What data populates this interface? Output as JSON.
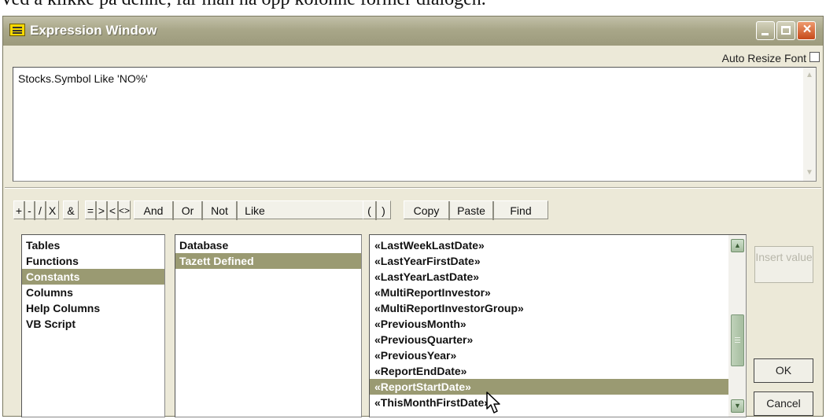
{
  "caption": "Ved å klikke på denne, får man nå opp kolonne former dialogen.",
  "window": {
    "title": "Expression Window"
  },
  "auto_resize": {
    "label": "Auto Resize Font",
    "checked": false
  },
  "expression": {
    "text": "Stocks.Symbol Like 'NO%'"
  },
  "operators": [
    "+",
    "-",
    "/",
    "X",
    "&",
    "=",
    ">",
    "<",
    "<>",
    "And",
    "Or",
    "Not",
    "Like",
    "(",
    ")",
    "Copy",
    "Paste",
    "Find"
  ],
  "categories": {
    "items": [
      "Tables",
      "Functions",
      "Constants",
      "Columns",
      "Help Columns",
      "VB Script"
    ],
    "selected": "Constants"
  },
  "sources": {
    "items": [
      "Database",
      "Tazett Defined"
    ],
    "selected": "Tazett Defined"
  },
  "values": {
    "items": [
      "«LastWeekLastDate»",
      "«LastYearFirstDate»",
      "«LastYearLastDate»",
      "«MultiReportInvestor»",
      "«MultiReportInvestorGroup»",
      "«PreviousMonth»",
      "«PreviousQuarter»",
      "«PreviousYear»",
      "«ReportEndDate»",
      "«ReportStartDate»",
      "«ThisMonthFirstDate»"
    ],
    "selected": "«ReportStartDate»"
  },
  "buttons": {
    "insert_value": "Insert value",
    "ok": "OK",
    "cancel": "Cancel"
  },
  "icons": {
    "app": "expression-window-icon",
    "cursor": "mouse-pointer-icon"
  },
  "colors": {
    "title_bar": "#a9a789",
    "selection": "#9a9a72",
    "dialog": "#ece9d8",
    "close_button": "#c64a1a"
  }
}
